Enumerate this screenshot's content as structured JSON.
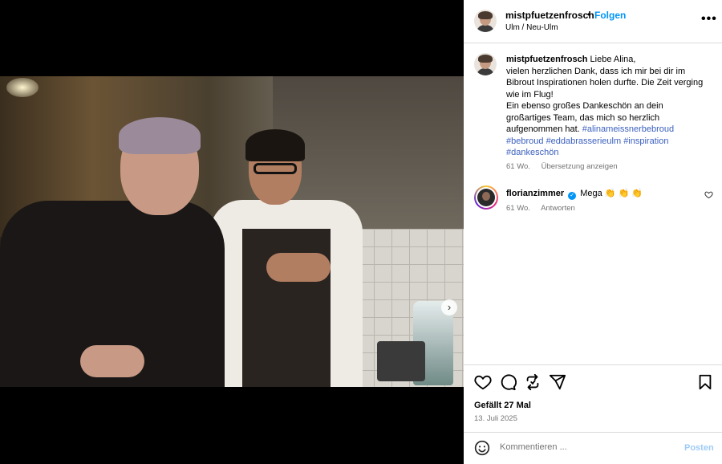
{
  "post": {
    "author": "mistpfuetzenfrosch",
    "separator": "•",
    "follow_label": "Folgen",
    "location": "Ulm / Neu-Ulm",
    "more_icon": "more-horizontal-icon",
    "media": {
      "current_slide": 1,
      "slide_count": 4,
      "next_icon": "chevron-right-icon"
    }
  },
  "caption": {
    "user": "mistpfuetzenfrosch",
    "text_1": "Liebe Alina,",
    "text_2": "vielen herzlichen Dank, dass ich mir bei dir im Bibrout Inspirationen holen durfte. Die Zeit verging wie im Flug!",
    "text_3": "Ein ebenso großes Dankeschön an dein großartiges Team, das mich so herzlich aufgenommen hat.",
    "tags": [
      "#alinameissnerbebroud",
      "#bebroud",
      "#eddabrasserieulm",
      "#inspiration",
      "#dankeschön"
    ],
    "time": "61 Wo.",
    "translate_label": "Übersetzung anzeigen"
  },
  "comment": {
    "user": "florianzimmer",
    "verified_mark": "✓",
    "text": "Mega 👏 👏 👏",
    "time": "61 Wo.",
    "reply_label": "Antworten",
    "like_icon": "heart-outline-icon"
  },
  "actions": {
    "likes": "Gefällt 27 Mal",
    "date": "13. Juli 2025",
    "icons": [
      "heart-icon",
      "comment-icon",
      "repost-icon",
      "share-icon",
      "bookmark-icon"
    ]
  },
  "composer": {
    "placeholder": "Kommentieren ...",
    "post_label": "Posten",
    "emoji_icon": "emoji-icon"
  },
  "colors": {
    "link_blue": "#0095f6",
    "hashtag": "#3a5fbf",
    "muted": "#737373"
  }
}
